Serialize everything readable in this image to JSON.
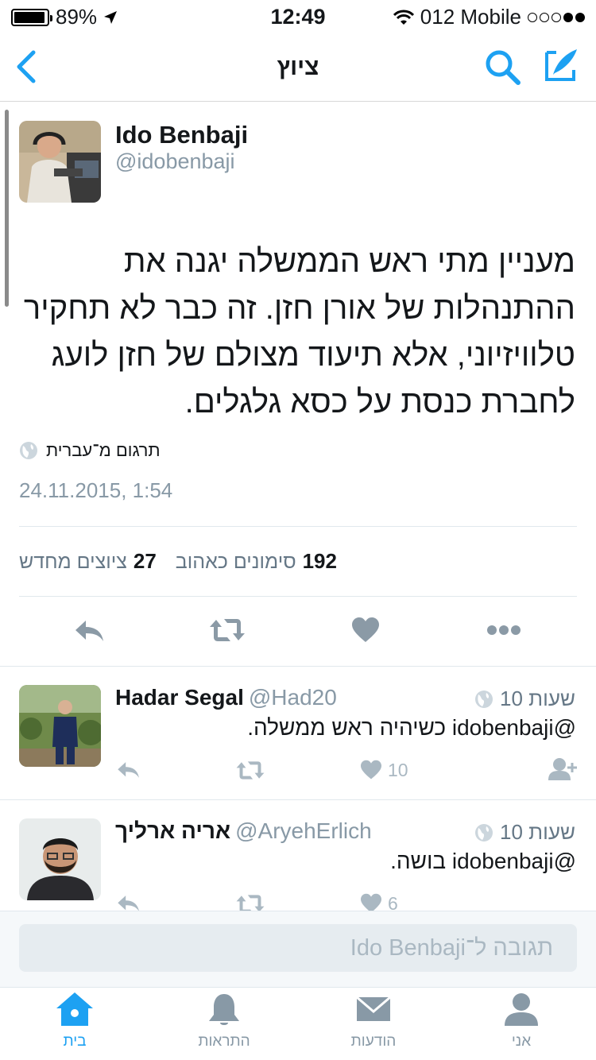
{
  "status_bar": {
    "battery": "89%",
    "time": "12:49",
    "carrier": "012 Mobile"
  },
  "nav": {
    "title": "ציוץ"
  },
  "tweet": {
    "name": "Ido Benbaji",
    "handle": "@idobenbaji",
    "text": "מעניין מתי ראש הממשלה יגנה את ההתנהלות של אורן חזן. זה כבר לא תחקיר טלוויזיוני, אלא תיעוד מצולם של חזן לועג לחברת כנסת על כסא גלגלים.",
    "translate_label": "תרגום מ־עברית",
    "timestamp": "24.11.2015, 1:54",
    "likes_count": "192",
    "likes_label": "סימונים כאהוב",
    "retweets_count": "27",
    "retweets_label": "ציוצים מחדש"
  },
  "replies": [
    {
      "name": "Hadar Segal",
      "handle": "@Had20",
      "time": "10 שעות",
      "mention": "@idobenbaji",
      "text": "כשיהיה ראש ממשלה.",
      "likes": "10"
    },
    {
      "name": "אריה ארליך",
      "handle": "@AryehErlich",
      "time": "10 שעות",
      "mention": "@idobenbaji",
      "text": "בושה.",
      "likes": "6"
    }
  ],
  "reply_box": {
    "placeholder": "תגובה ל־Ido Benbaji"
  },
  "tabs": [
    {
      "label": "בית",
      "icon": "home-icon"
    },
    {
      "label": "התראות",
      "icon": "bell-icon"
    },
    {
      "label": "הודעות",
      "icon": "envelope-icon"
    },
    {
      "label": "אני",
      "icon": "person-icon"
    }
  ],
  "colors": {
    "accent": "#1da1f2",
    "muted": "#8899a6",
    "action_gray": "#8b9aa6"
  }
}
